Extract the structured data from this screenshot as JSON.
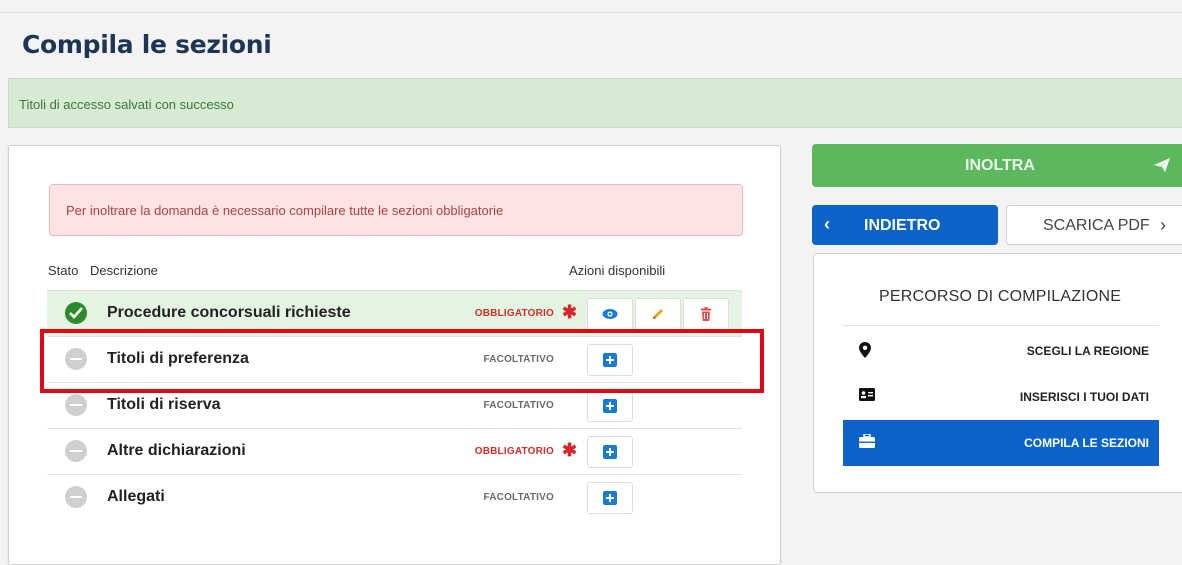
{
  "page": {
    "title": "Compila le sezioni"
  },
  "alerts": {
    "success": "Titoli di accesso salvati con successo",
    "warning": "Per inoltrare la domanda è necessario compilare tutte le sezioni obbligatorie"
  },
  "table": {
    "headers": {
      "stato": "Stato",
      "descrizione": "Descrizione",
      "azioni": "Azioni disponibili"
    },
    "rows": [
      {
        "status": "completed",
        "description": "Procedure concorsuali richieste",
        "tag": "OBBLIGATORIO",
        "required": true,
        "actions": [
          "view-icon",
          "edit-icon",
          "delete-icon"
        ]
      },
      {
        "status": "empty",
        "description": "Titoli di preferenza",
        "tag": "FACOLTATIVO",
        "required": false,
        "actions": [
          "add-icon"
        ]
      },
      {
        "status": "empty",
        "description": "Titoli di riserva",
        "tag": "FACOLTATIVO",
        "required": false,
        "actions": [
          "add-icon"
        ]
      },
      {
        "status": "empty",
        "description": "Altre dichiarazioni",
        "tag": "OBBLIGATORIO",
        "required": true,
        "actions": [
          "add-icon"
        ]
      },
      {
        "status": "empty",
        "description": "Allegati",
        "tag": "FACOLTATIVO",
        "required": false,
        "actions": [
          "add-icon"
        ]
      }
    ]
  },
  "actions": {
    "inoltra": "INOLTRA",
    "indietro": "INDIETRO",
    "scarica": "SCARICA PDF"
  },
  "percorso": {
    "title": "PERCORSO DI COMPILAZIONE",
    "items": [
      {
        "label": "SCEGLI LA REGIONE",
        "icon": "map-marker-icon",
        "active": false
      },
      {
        "label": "INSERISCI I TUOI DATI",
        "icon": "id-card-icon",
        "active": false
      },
      {
        "label": "COMPILA LE SEZIONI",
        "icon": "briefcase-icon",
        "active": true
      }
    ]
  },
  "colors": {
    "primary": "#0b63c7",
    "success": "#5cb85c",
    "danger": "#d9262a",
    "highlight": "#e30613"
  }
}
